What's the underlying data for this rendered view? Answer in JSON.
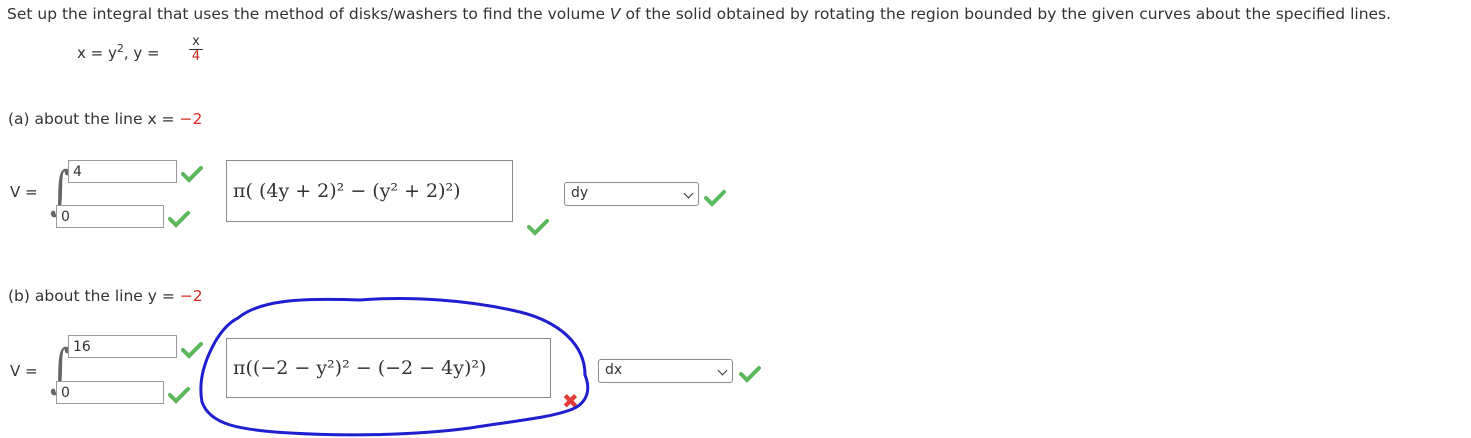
{
  "prompt": {
    "before_v": "Set up the integral that uses the method of disks/washers to find the volume ",
    "v": "V",
    "after_v": " of the solid obtained by rotating the region bounded by the given curves about the specified lines."
  },
  "curves": {
    "eq1": "x = y",
    "eq1_exp": "2",
    "sep": ",  y = ",
    "frac_num": "x",
    "frac_den": "4"
  },
  "part_a": {
    "label": "(a) about the line ",
    "line_var": "x",
    "line_eq": " = ",
    "line_val": "−2",
    "v_label": "V =",
    "upper": "4",
    "lower": "0",
    "expression": "π( (4y + 2)² − (y² + 2)²)",
    "differential": "dy",
    "upper_status": "correct",
    "lower_status": "correct",
    "expression_status": "correct",
    "differential_status": "correct"
  },
  "part_b": {
    "label": "(b) about the line ",
    "line_var": "y",
    "line_eq": " = ",
    "line_val": "−2",
    "v_label": "V =",
    "upper": "16",
    "lower": "0",
    "expression": "π((−2 − y²)² − (−2 − 4y)²)",
    "differential": "dx",
    "upper_status": "correct",
    "lower_status": "correct",
    "expression_status": "incorrect",
    "differential_status": "correct"
  },
  "colors": {
    "correct": "#5cb85c",
    "incorrect": "#e23b3b",
    "annotation": "#1f1fcf",
    "highlight": "#d9281f"
  }
}
